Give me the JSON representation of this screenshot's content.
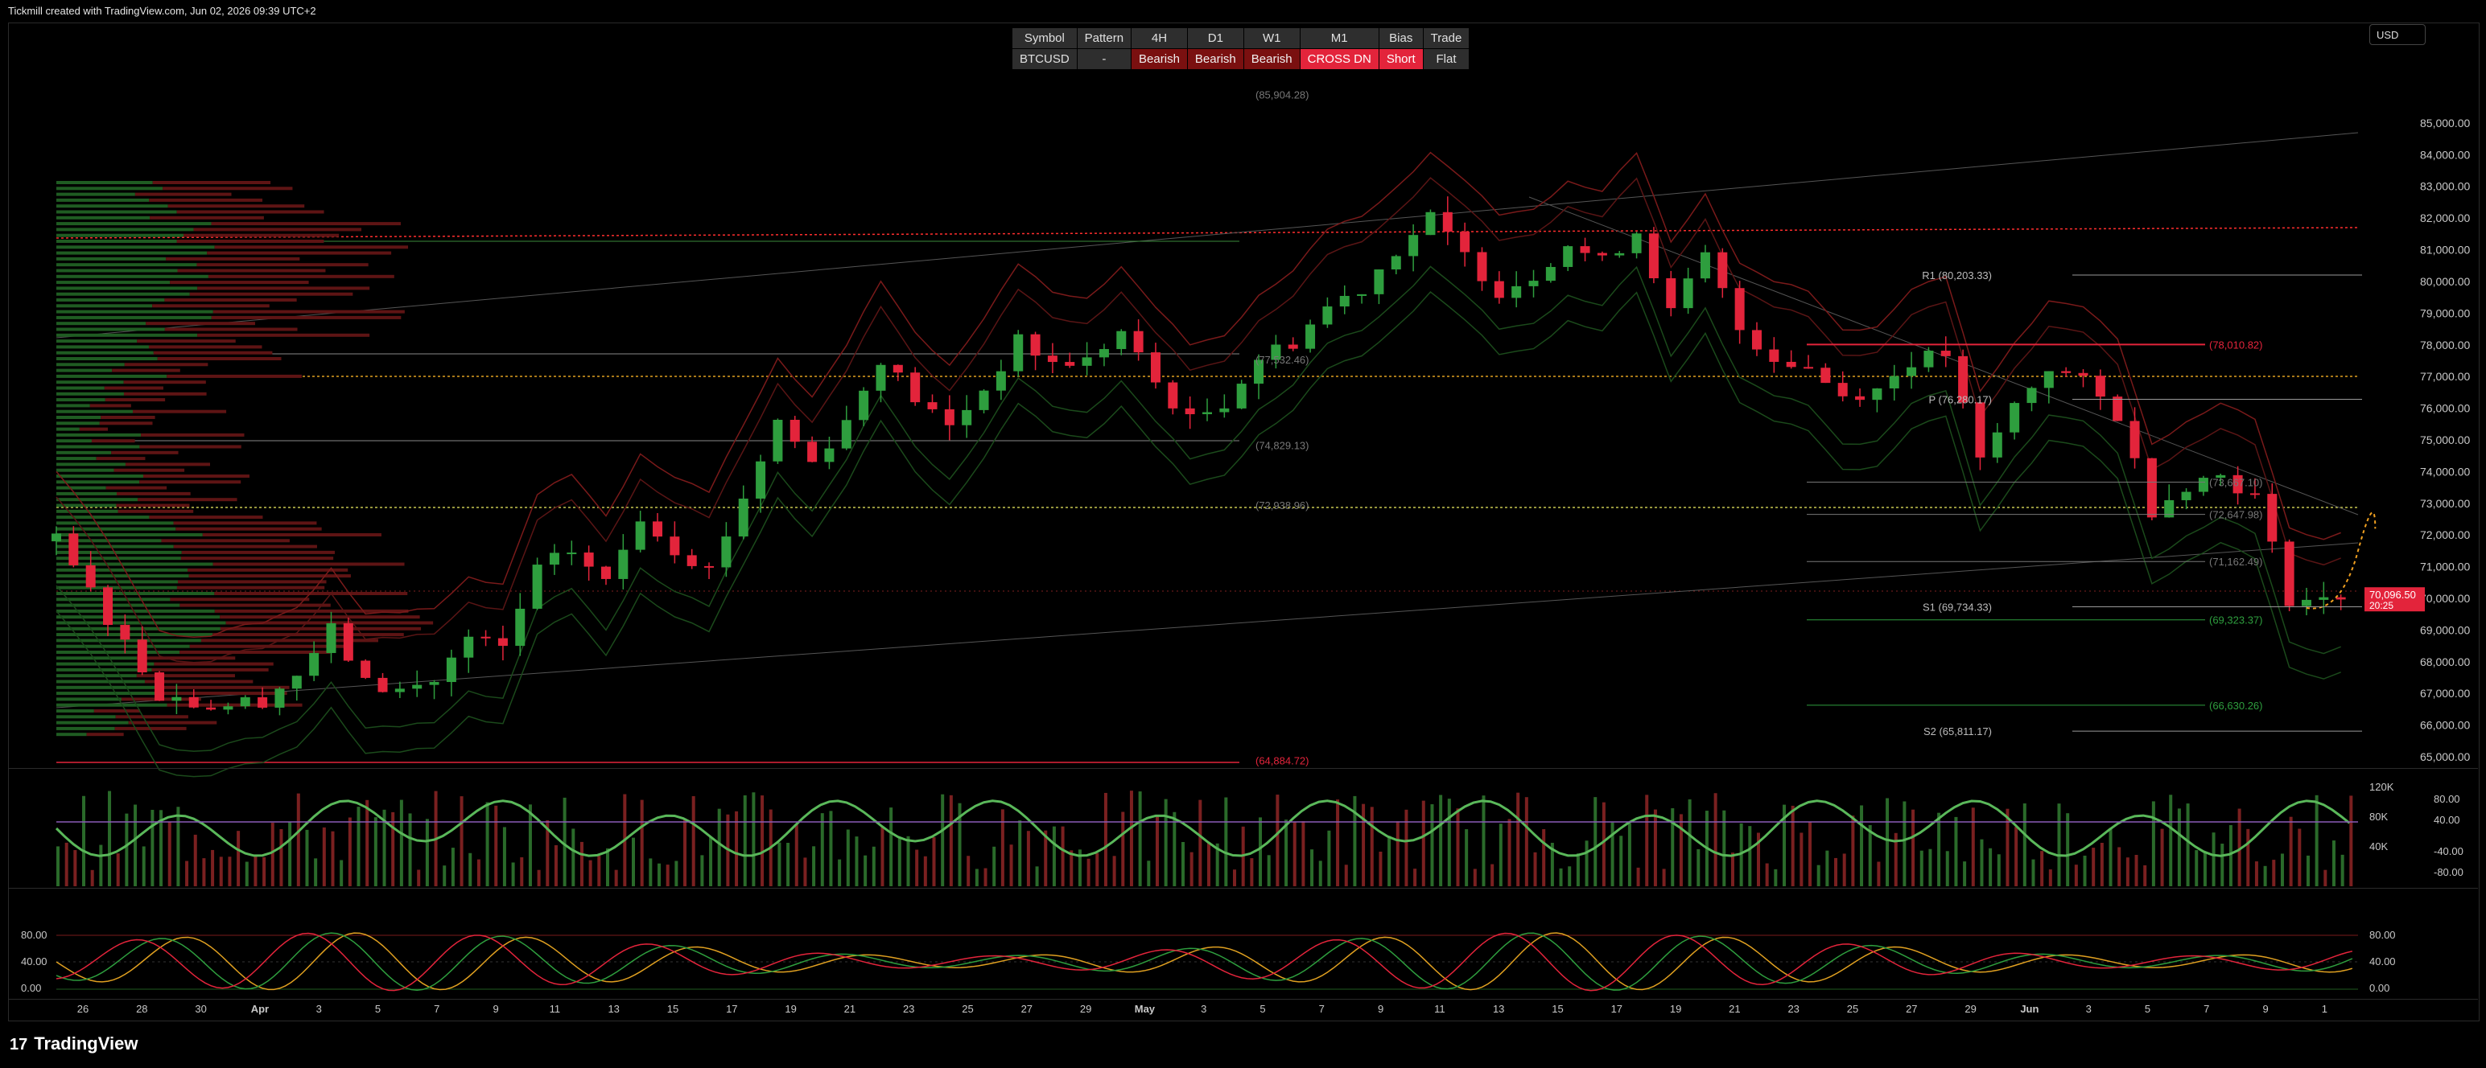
{
  "header": {
    "text": "Tickmill created with TradingView.com, Jun 02, 2026 09:39 UTC+2"
  },
  "currency_button": "USD",
  "brand": {
    "logo_mark": "17",
    "name": "TradingView"
  },
  "status_table": {
    "headers": [
      "Symbol",
      "Pattern",
      "4H",
      "D1",
      "W1",
      "M1",
      "Bias",
      "Trade"
    ],
    "values": [
      "BTCUSD",
      "-",
      "Bearish",
      "Bearish",
      "Bearish",
      "CROSS DN",
      "Short",
      "Flat"
    ],
    "styles": [
      "v",
      "v",
      "b",
      "b",
      "b",
      "s",
      "s",
      "v"
    ]
  },
  "colors": {
    "bull": "#2e9e3e",
    "bear": "#e3243b",
    "accent": "#ff2e2e",
    "panel_bg": "#000000"
  },
  "chart_data": [
    {
      "type": "candlestick",
      "symbol": "BTCUSD",
      "yaxis_ticks": [
        "85,000.00",
        "84,000.00",
        "83,000.00",
        "82,000.00",
        "81,000.00",
        "80,000.00",
        "79,000.00",
        "78,000.00",
        "77,000.00",
        "76,000.00",
        "75,000.00",
        "74,000.00",
        "73,000.00",
        "72,000.00",
        "71,000.00",
        "70,000.00",
        "69,000.00",
        "68,000.00",
        "67,000.00",
        "66,000.00",
        "65,000.00"
      ],
      "ylim": [
        64900,
        86800
      ],
      "x_labels": [
        "26",
        "28",
        "30",
        "Apr",
        "3",
        "5",
        "7",
        "9",
        "11",
        "13",
        "15",
        "17",
        "19",
        "21",
        "23",
        "25",
        "27",
        "29",
        "May",
        "3",
        "5",
        "7",
        "9",
        "11",
        "13",
        "15",
        "17",
        "19",
        "21",
        "23",
        "25",
        "27",
        "29",
        "Jun",
        "3",
        "5",
        "7",
        "9",
        "1"
      ],
      "close_path": [
        [
          0,
          71800
        ],
        [
          2,
          70200
        ],
        [
          4,
          68600
        ],
        [
          6,
          67000
        ],
        [
          9,
          66600
        ],
        [
          12,
          66800
        ],
        [
          14,
          67600
        ],
        [
          16,
          69000
        ],
        [
          18,
          67300
        ],
        [
          20,
          67100
        ],
        [
          22,
          67400
        ],
        [
          24,
          68700
        ],
        [
          26,
          68400
        ],
        [
          28,
          70900
        ],
        [
          30,
          71500
        ],
        [
          32,
          70500
        ],
        [
          34,
          72600
        ],
        [
          36,
          71600
        ],
        [
          38,
          70900
        ],
        [
          40,
          73200
        ],
        [
          42,
          75600
        ],
        [
          44,
          74300
        ],
        [
          46,
          75600
        ],
        [
          48,
          77600
        ],
        [
          50,
          76300
        ],
        [
          52,
          75400
        ],
        [
          54,
          76600
        ],
        [
          56,
          78100
        ],
        [
          58,
          77400
        ],
        [
          60,
          77500
        ],
        [
          62,
          78400
        ],
        [
          64,
          76800
        ],
        [
          66,
          75600
        ],
        [
          68,
          76200
        ],
        [
          70,
          77600
        ],
        [
          72,
          78100
        ],
        [
          74,
          79200
        ],
        [
          76,
          79800
        ],
        [
          78,
          81000
        ],
        [
          80,
          82000
        ],
        [
          82,
          80800
        ],
        [
          84,
          79700
        ],
        [
          86,
          80200
        ],
        [
          88,
          81200
        ],
        [
          90,
          80600
        ],
        [
          92,
          81600
        ],
        [
          94,
          79000
        ],
        [
          96,
          80800
        ],
        [
          98,
          78500
        ],
        [
          100,
          77600
        ],
        [
          102,
          77300
        ],
        [
          104,
          76400
        ],
        [
          106,
          76600
        ],
        [
          108,
          77500
        ],
        [
          110,
          77700
        ],
        [
          112,
          74300
        ],
        [
          114,
          76100
        ],
        [
          116,
          77300
        ],
        [
          118,
          76800
        ],
        [
          120,
          75800
        ],
        [
          122,
          72800
        ],
        [
          124,
          73600
        ],
        [
          126,
          73900
        ],
        [
          128,
          73200
        ],
        [
          130,
          70000
        ],
        [
          132,
          69900
        ],
        [
          133,
          70100
        ]
      ],
      "volume_axis": [
        "120K",
        "80K",
        "40K"
      ],
      "rsi_axis": [
        "80.00",
        "40.00",
        "-40.00",
        "-80.00"
      ],
      "stoch_axis": [
        "80.00",
        "40.00",
        "0.00"
      ],
      "levels": [
        {
          "label": "R1 (80,203.33)",
          "value": 80203.33
        },
        {
          "label": "(78,010.82)",
          "value": 78010.82
        },
        {
          "label": "P (76,280.17)",
          "value": 76280.17
        },
        {
          "label": "(73,667.10)",
          "value": 73667.1
        },
        {
          "label": "(72,647.98)",
          "value": 72647.98
        },
        {
          "label": "(71,162.49)",
          "value": 71162.49
        },
        {
          "label": "S1 (69,734.33)",
          "value": 69734.33
        },
        {
          "label": "(69,323.37)",
          "value": 69323.37
        },
        {
          "label": "(66,630.26)",
          "value": 66630.26
        },
        {
          "label": "S2 (65,811.17)",
          "value": 65811.17
        },
        {
          "label": "(64,884.72)",
          "value": 64884.72
        },
        {
          "label": "(74,829.13)",
          "value": 74829.13
        },
        {
          "label": "(72,938.96)",
          "value": 72938.96
        },
        {
          "label": "(77,532.46)",
          "value": 77532.46
        },
        {
          "label": "(85,904.28)",
          "value": 85904.28
        }
      ],
      "last_price": {
        "value": "70,096.50",
        "countdown": "20:25"
      }
    }
  ]
}
